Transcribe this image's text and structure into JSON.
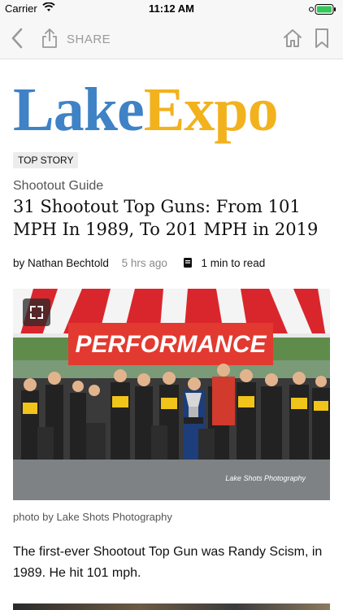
{
  "status_bar": {
    "carrier": "Carrier",
    "time": "11:12 AM"
  },
  "nav": {
    "share_label": "SHARE"
  },
  "logo": {
    "part1": "Lake",
    "part2": "Expo"
  },
  "article": {
    "badge": "TOP STORY",
    "category": "Shootout Guide",
    "headline": "31 Shootout Top Guns: From 101 MPH In 1989, To 201 MPH in 2019",
    "author": "by Nathan Bechtold",
    "time_ago": "5 hrs ago",
    "read_time": "1 min to read",
    "photo": {
      "banner_text": "PERFORMANCE",
      "overlay_credit": "Lake Shots Photography"
    },
    "caption": "photo by Lake Shots Photography",
    "body": "The first-ever Shootout Top Gun was Randy Scism, in 1989. He hit 101 mph."
  },
  "colors": {
    "lake": "#3f82c6",
    "expo": "#f2b21e",
    "nav_icon": "#9a9a9a"
  },
  "icons": [
    "wifi-icon",
    "battery-icon",
    "back-chevron-icon",
    "share-icon",
    "home-icon",
    "bookmark-icon",
    "book-icon",
    "expand-icon"
  ]
}
